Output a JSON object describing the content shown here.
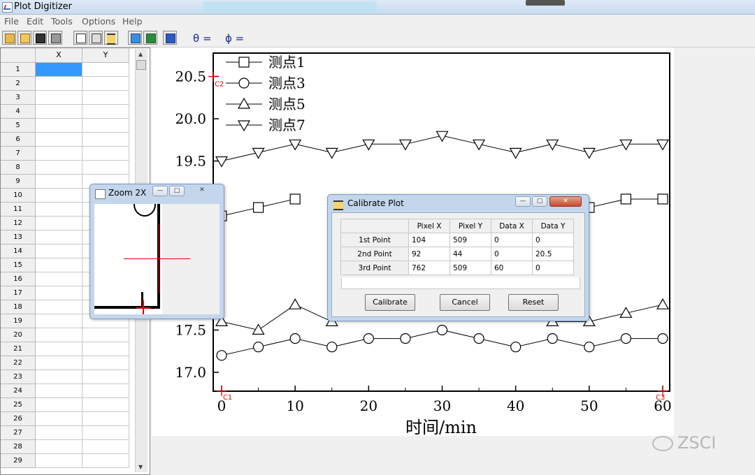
{
  "window": {
    "title": "Plot Digitizer"
  },
  "menu": [
    "File",
    "Edit",
    "Tools",
    "Options",
    "Help"
  ],
  "toolbar": {
    "theta_label": "θ =",
    "phi_label": "ϕ ="
  },
  "grid": {
    "columns": [
      "X",
      "Y"
    ],
    "rows": [
      "1",
      "2",
      "3",
      "4",
      "5",
      "6",
      "7",
      "8",
      "9",
      "10",
      "11",
      "12",
      "13",
      "14",
      "15",
      "16",
      "17",
      "18",
      "19",
      "20",
      "21",
      "22",
      "23",
      "24",
      "25",
      "26",
      "27",
      "28",
      "29"
    ]
  },
  "chart_data": {
    "type": "line",
    "x": [
      0,
      5,
      10,
      15,
      20,
      25,
      30,
      35,
      40,
      45,
      50,
      55,
      60
    ],
    "series": [
      {
        "name": "测点1",
        "marker": "square",
        "values": [
          18.85,
          18.95,
          19.05,
          null,
          null,
          null,
          null,
          null,
          null,
          null,
          18.95,
          19.05,
          19.05
        ]
      },
      {
        "name": "测点3",
        "marker": "circle",
        "values": [
          17.2,
          17.3,
          17.4,
          17.3,
          17.4,
          17.4,
          17.5,
          17.4,
          17.3,
          17.4,
          17.3,
          17.4,
          17.4
        ]
      },
      {
        "name": "测点5",
        "marker": "triangle-up",
        "values": [
          17.6,
          17.5,
          17.8,
          17.6,
          null,
          null,
          null,
          null,
          null,
          17.6,
          17.6,
          17.7,
          17.8
        ]
      },
      {
        "name": "测点7",
        "marker": "triangle-down",
        "values": [
          19.5,
          19.6,
          19.7,
          19.6,
          19.7,
          19.7,
          19.8,
          19.7,
          19.6,
          19.7,
          19.6,
          19.7,
          19.7
        ]
      }
    ],
    "xlabel": "时间/min",
    "xlim": [
      0,
      60
    ],
    "xticks": [
      "0",
      "10",
      "20",
      "30",
      "40",
      "50",
      "60"
    ],
    "yticks": [
      "17.0",
      "17.5",
      "19.5",
      "20.0",
      "20.5"
    ],
    "legend": "top-left",
    "calibration_markers": [
      "C1",
      "C2",
      "C3"
    ]
  },
  "zoom": {
    "title": "Zoom 2X"
  },
  "calibrate": {
    "title": "Calibrate Plot",
    "headers": [
      "",
      "Pixel X",
      "Pixel Y",
      "Data X",
      "Data Y"
    ],
    "rows": [
      [
        "1st Point",
        "104",
        "509",
        "0",
        "0"
      ],
      [
        "2nd Point",
        "92",
        "44",
        "0",
        "20.5"
      ],
      [
        "3rd Point",
        "762",
        "509",
        "60",
        "0"
      ]
    ],
    "buttons": {
      "calibrate": "Calibrate",
      "cancel": "Cancel",
      "reset": "Reset"
    }
  },
  "watermark": "ZSCI",
  "colors": {
    "selection": "#3399ff",
    "crosshair": "#e00000",
    "title_bar": "#c9dcf1"
  },
  "icons": [
    "open-icon",
    "open-folder-icon",
    "copy-icon",
    "print-icon",
    "digitize-icon",
    "paste-icon",
    "calibrate-icon",
    "excel-icon",
    "chart-icon",
    "word-icon"
  ]
}
